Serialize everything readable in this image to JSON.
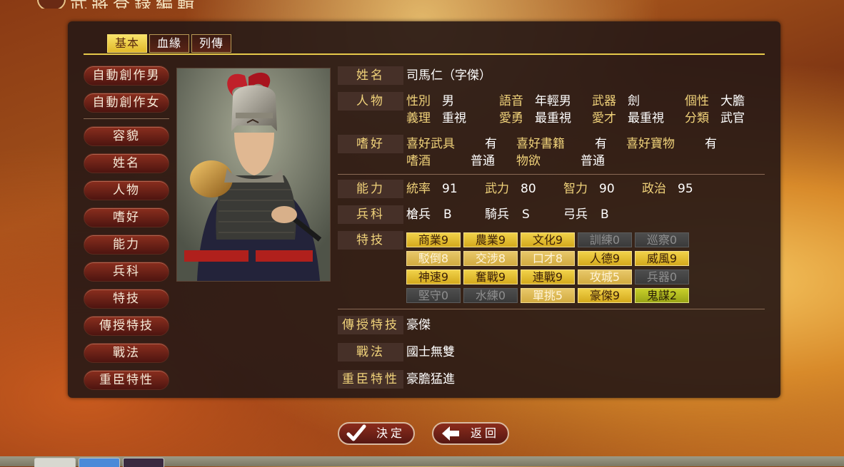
{
  "title": "武將登錄編輯",
  "tabs": [
    "基本",
    "血緣",
    "列傳"
  ],
  "side_buttons": [
    "自動創作男",
    "自動創作女",
    "容貌",
    "姓名",
    "人物",
    "嗜好",
    "能力",
    "兵科",
    "特技",
    "傳授特技",
    "戰法",
    "重臣特性"
  ],
  "labels": {
    "name": "姓名",
    "person": "人物",
    "hobby": "嗜好",
    "ability": "能力",
    "troops": "兵科",
    "skills": "特技",
    "teach": "傳授特技",
    "tactic": "戰法",
    "trait": "重臣特性"
  },
  "name_value": "司馬仁（字傑）",
  "person": [
    {
      "key": "性別",
      "value": "男"
    },
    {
      "key": "語音",
      "value": "年輕男"
    },
    {
      "key": "武器",
      "value": "劍"
    },
    {
      "key": "個性",
      "value": "大膽"
    },
    {
      "key": "義理",
      "value": "重視"
    },
    {
      "key": "愛勇",
      "value": "最重視"
    },
    {
      "key": "愛才",
      "value": "最重視"
    },
    {
      "key": "分類",
      "value": "武官"
    }
  ],
  "hobbies": [
    {
      "key": "喜好武具",
      "value": "有"
    },
    {
      "key": "喜好書籍",
      "value": "有"
    },
    {
      "key": "喜好寶物",
      "value": "有"
    },
    {
      "key": "嗜酒",
      "value": "普通"
    },
    {
      "key": "物欲",
      "value": "普通"
    }
  ],
  "abilities": [
    {
      "key": "統率",
      "value": "91"
    },
    {
      "key": "武力",
      "value": "80"
    },
    {
      "key": "智力",
      "value": "90"
    },
    {
      "key": "政治",
      "value": "95"
    }
  ],
  "troops": [
    {
      "key": "槍兵",
      "value": "B"
    },
    {
      "key": "騎兵",
      "value": "S"
    },
    {
      "key": "弓兵",
      "value": "B"
    }
  ],
  "skills": [
    {
      "label": "商業9",
      "state": "hi"
    },
    {
      "label": "農業9",
      "state": "hi"
    },
    {
      "label": "文化9",
      "state": "hi"
    },
    {
      "label": "訓練0",
      "state": "off"
    },
    {
      "label": "巡察0",
      "state": "off"
    },
    {
      "label": "駁倒8",
      "state": "mid"
    },
    {
      "label": "交涉8",
      "state": "mid"
    },
    {
      "label": "口才8",
      "state": "mid"
    },
    {
      "label": "人德9",
      "state": "hi"
    },
    {
      "label": "威風9",
      "state": "hi"
    },
    {
      "label": "神速9",
      "state": "hi"
    },
    {
      "label": "奮戰9",
      "state": "hi"
    },
    {
      "label": "連戰9",
      "state": "hi"
    },
    {
      "label": "攻城5",
      "state": "mid"
    },
    {
      "label": "兵器0",
      "state": "off"
    },
    {
      "label": "堅守0",
      "state": "off"
    },
    {
      "label": "水練0",
      "state": "off"
    },
    {
      "label": "單挑5",
      "state": "mid"
    },
    {
      "label": "豪傑9",
      "state": "hi"
    },
    {
      "label": "鬼謀2",
      "state": "grn"
    }
  ],
  "teach_value": "豪傑",
  "tactic_value": "國士無雙",
  "trait_value": "豪膽猛進",
  "buttons": {
    "confirm": "決定",
    "back": "返回"
  },
  "colors": {
    "accent_gold": "#f0d27a",
    "panel": "#2a1a16",
    "button_red": "#8c2c1c"
  }
}
